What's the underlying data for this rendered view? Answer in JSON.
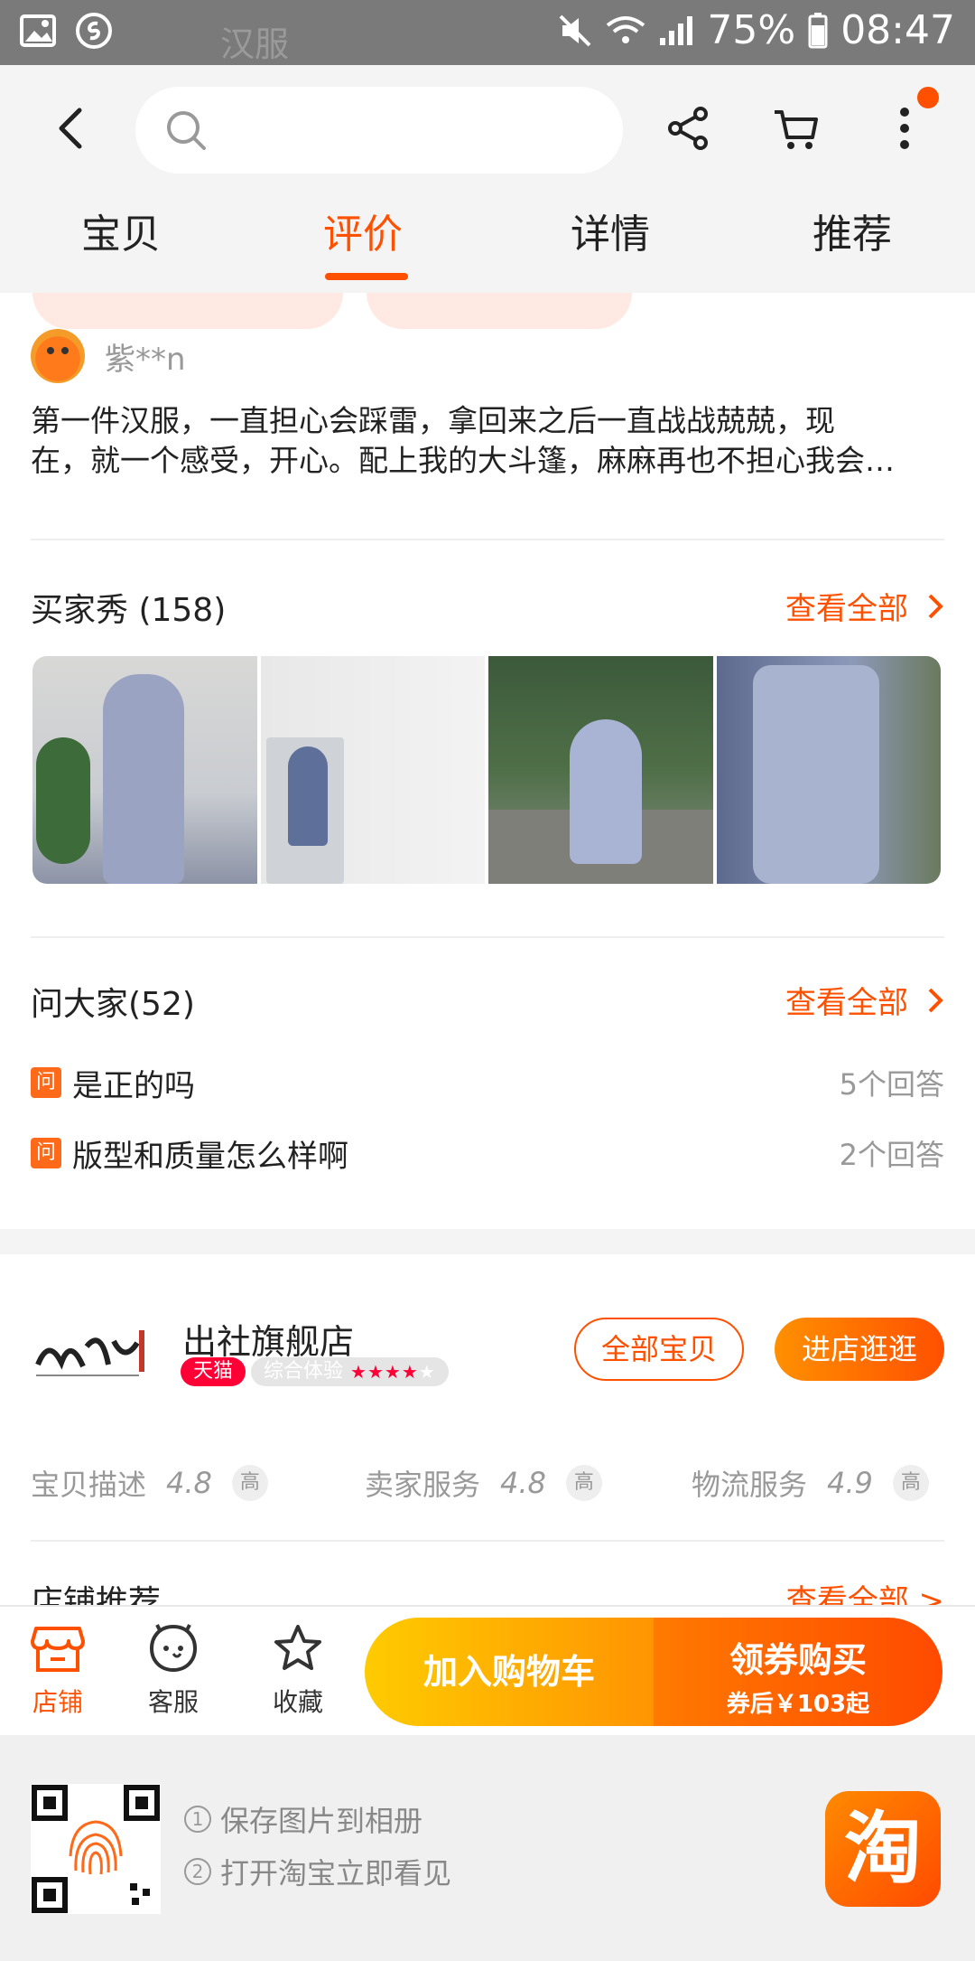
{
  "statusbar": {
    "battery": "75%",
    "time": "08:47"
  },
  "header": {
    "search_placeholder": "汉服"
  },
  "tabs": [
    {
      "label": "宝贝",
      "active": false
    },
    {
      "label": "评价",
      "active": true
    },
    {
      "label": "详情",
      "active": false
    },
    {
      "label": "推荐",
      "active": false
    }
  ],
  "review": {
    "user": "紫**n",
    "text_line1": "第一件汉服，一直担心会踩雷，拿回来之后一直战战兢兢，现",
    "text_line2": "在，就一个感受，开心。配上我的大斗篷，麻麻再也不担心我会…"
  },
  "buyer_show": {
    "title": "买家秀 (158)",
    "see_all": "查看全部"
  },
  "qa": {
    "title": "问大家(52)",
    "see_all": "查看全部",
    "badge": "问",
    "items": [
      {
        "question": "是正的吗",
        "answers": "5个回答"
      },
      {
        "question": "版型和质量怎么样啊",
        "answers": "2个回答"
      }
    ]
  },
  "shop": {
    "name": "出社旗舰店",
    "tmall_badge": "天猫",
    "experience_label": "综合体验",
    "all_items_button": "全部宝贝",
    "visit_button": "进店逛逛",
    "ratings": [
      {
        "label": "宝贝描述",
        "value": "4.8",
        "level": "高"
      },
      {
        "label": "卖家服务",
        "value": "4.8",
        "level": "高"
      },
      {
        "label": "物流服务",
        "value": "4.9",
        "level": "高"
      }
    ],
    "rec_title": "店铺推荐",
    "rec_see_all": "查看全部 >"
  },
  "bottombar": {
    "shop": "店铺",
    "service": "客服",
    "favorite": "收藏",
    "add_cart": "加入购物车",
    "buy_title": "领券购买",
    "buy_sub": "券后￥103起"
  },
  "footer": {
    "tip1": "保存图片到相册",
    "tip2": "打开淘宝立即看见",
    "logo": "淘"
  },
  "colors": {
    "accent": "#ff5000",
    "tmall": "#ff0036"
  }
}
